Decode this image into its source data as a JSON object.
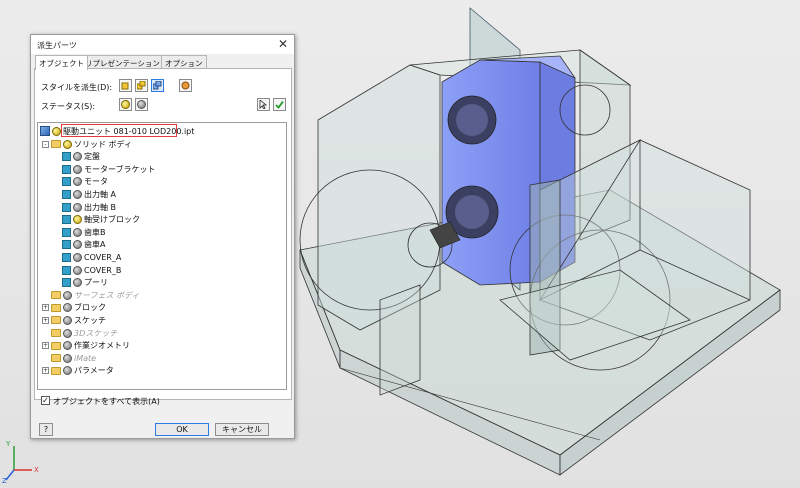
{
  "dialog": {
    "title": "派生パーツ",
    "close_glyph": "✕",
    "tabs": [
      "オブジェクト",
      "リプレゼンテーション",
      "オプション"
    ],
    "style_label": "スタイルを派生(D):",
    "status_label": "ステータス(S):",
    "tree": {
      "root_label": "駆動ユニット 081-010 LOD200.ipt",
      "items": [
        {
          "label": "ソリッド ボディ",
          "level": 1,
          "kind": "folder",
          "dim": false,
          "expander": "-"
        },
        {
          "label": "定盤",
          "level": 2,
          "kind": "body",
          "dim": false
        },
        {
          "label": "モーターブラケット",
          "level": 2,
          "kind": "body",
          "dim": false
        },
        {
          "label": "モータ",
          "level": 2,
          "kind": "body",
          "dim": false
        },
        {
          "label": "出力軸 A",
          "level": 2,
          "kind": "body",
          "dim": false
        },
        {
          "label": "出力軸 B",
          "level": 2,
          "kind": "body",
          "dim": false
        },
        {
          "label": "軸受けブロック",
          "level": 2,
          "kind": "body",
          "dim": false,
          "yellow": true
        },
        {
          "label": "歯車B",
          "level": 2,
          "kind": "body",
          "dim": false
        },
        {
          "label": "歯車A",
          "level": 2,
          "kind": "body",
          "dim": false
        },
        {
          "label": "COVER_A",
          "level": 2,
          "kind": "body",
          "dim": false
        },
        {
          "label": "COVER_B",
          "level": 2,
          "kind": "body",
          "dim": false
        },
        {
          "label": "プーリ",
          "level": 2,
          "kind": "body",
          "dim": false
        },
        {
          "label": "サーフェス ボディ",
          "level": 1,
          "kind": "folder",
          "dim": true
        },
        {
          "label": "ブロック",
          "level": 1,
          "kind": "folder",
          "dim": false,
          "expander": "+"
        },
        {
          "label": "スケッチ",
          "level": 1,
          "kind": "folder",
          "dim": false,
          "expander": "+"
        },
        {
          "label": "3Dスケッチ",
          "level": 1,
          "kind": "folder",
          "dim": true
        },
        {
          "label": "作業ジオメトリ",
          "level": 1,
          "kind": "folder",
          "dim": false,
          "expander": "+"
        },
        {
          "label": "iMate",
          "level": 1,
          "kind": "folder",
          "dim": true
        },
        {
          "label": "パラメータ",
          "level": 1,
          "kind": "folder",
          "dim": false,
          "expander": "+"
        }
      ]
    },
    "show_all_label": "オブジェクトをすべて表示(A)",
    "show_all_checked": "✓",
    "ok_label": "OK",
    "cancel_label": "キャンセル",
    "help_glyph": "?"
  },
  "axis": {
    "x": "X",
    "y": "Y",
    "z": "Z"
  },
  "colors": {
    "highlight_body": "#7f8ff0",
    "accent": "#2c7be5",
    "root_box": "#e23b3b"
  }
}
